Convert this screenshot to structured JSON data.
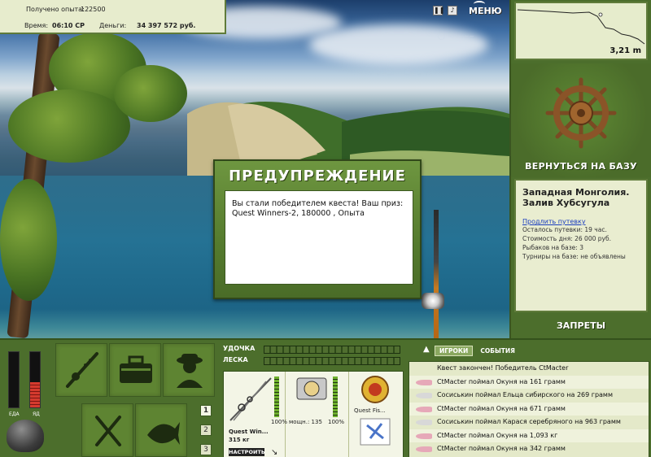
{
  "info": {
    "exp_label": "Получено опыта:",
    "exp_value": "122500",
    "time_label": "Время:",
    "time_value": "06:10 СР",
    "money_label": "Деньги:",
    "money_value": "34 397 572 руб."
  },
  "top": {
    "pause_icon": "pause-icon",
    "sound_icon": "sound-icon",
    "menu_label": "МЕНЮ"
  },
  "depth": {
    "value": "3,21 m"
  },
  "right": {
    "back_label": "ВЕРНУТЬСЯ НА БАЗУ",
    "location_title": "Западная Монголия. Залив Хубсугула",
    "extend_link": "Продлить путевку",
    "lines": [
      "Осталось путевки: 19 час.",
      "Стоимость дня: 26 000 руб.",
      "Рыбаков на базе: 3",
      "Турниры на базе: не объявлены"
    ],
    "bans_label": "ЗАПРЕТЫ"
  },
  "dialog": {
    "title": "ПРЕДУПРЕЖДЕНИЕ",
    "message": "Вы стали победителем квеста! Ваш приз: Quest Winners-2, 180000 , Опыта"
  },
  "meters": {
    "food_label": "ЕДА",
    "poison_label": "ЯД",
    "food_level": 0.0,
    "poison_level": 0.45
  },
  "tiles": [
    "rod-tile",
    "tackle-box-tile",
    "fisherman-tile",
    "food-tile",
    "fish-tile"
  ],
  "pages": [
    "1",
    "2",
    "3"
  ],
  "gear": {
    "rod_label": "УДОЧКА",
    "line_label": "ЛЕСКА",
    "rod_name": "Quest Win...",
    "rod_weight": "315 кг",
    "rod_percent": "100%",
    "reel_power": "мощн.: 135",
    "reel_percent": "100%",
    "lure_name": "Quest Fis...",
    "set_button": "НАСТРОИТЬ"
  },
  "events": {
    "tab_players": "ИГРОКИ",
    "tab_events": "СОБЫТИЯ",
    "items": [
      "Квест закончен! Победитель CtMacter",
      "CtMacter поймал Окуня на 161 грамм",
      "Сосиськин поймал Ельца сибирского на 269 грамм",
      "CtMacter поймал Окуня на 671 грамм",
      "Сосиськин поймал Карася серебряного на 963 грамм",
      "CtMacter поймал Окуня на 1,093 кг",
      "CtMacter поймал Окуня на 342 грамм"
    ],
    "fish_colors": [
      "#e6a8b8",
      "#e6a8b8",
      "#d8d8d8",
      "#e6a8b8",
      "#d8d8d8",
      "#e6a8b8",
      "#e6a8b8"
    ],
    "first_has_icon": false
  },
  "colors": {
    "panel_green": "#4c6e2c",
    "light_panel": "#e9edd0",
    "accent_red": "#c42a22"
  }
}
